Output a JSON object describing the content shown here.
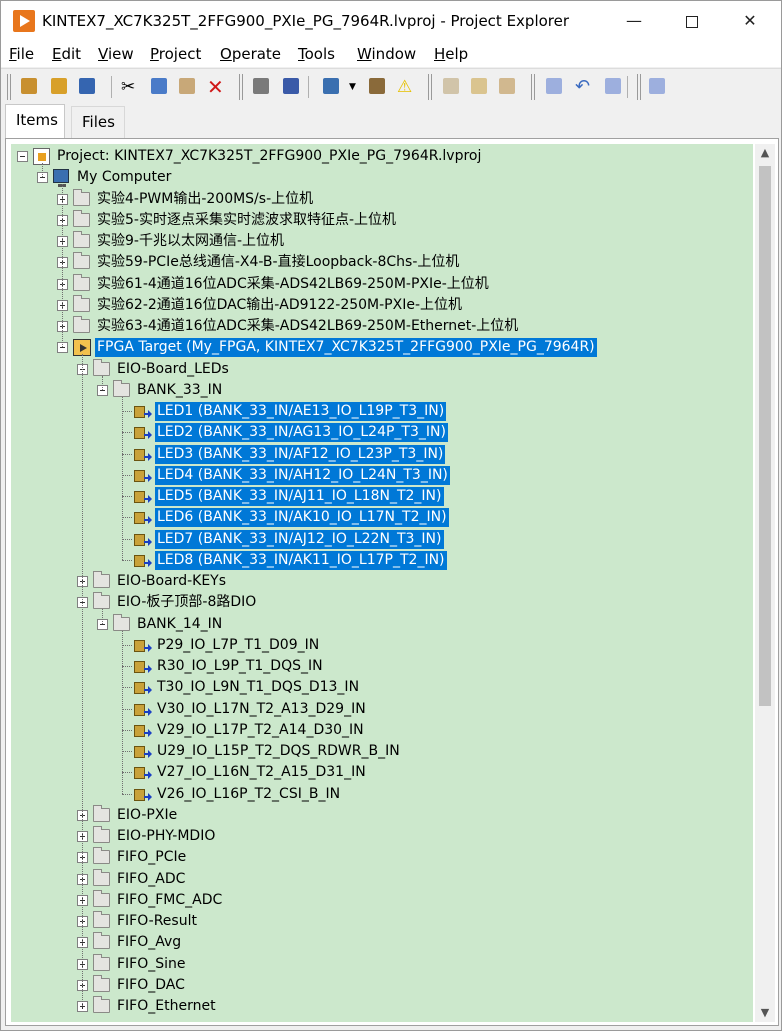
{
  "window": {
    "title": "KINTEX7_XC7K325T_2FFG900_PXIe_PG_7964R.lvproj - Project Explorer",
    "min_glyph": "—",
    "close_glyph": "✕"
  },
  "menu": [
    {
      "label": "File"
    },
    {
      "label": "Edit"
    },
    {
      "label": "View"
    },
    {
      "label": "Project"
    },
    {
      "label": "Operate"
    },
    {
      "label": "Tools"
    },
    {
      "label": "Window"
    },
    {
      "label": "Help"
    }
  ],
  "toolbar": {
    "icons": [
      "new-icon",
      "open-icon",
      "save-all-icon",
      "cut-icon",
      "copy-icon",
      "paste-icon",
      "delete-icon",
      "build-icon",
      "save-icon",
      "view-icon",
      "dropdown-icon",
      "deploy-icon",
      "warning-icon",
      "build-spec-icon",
      "properties-icon",
      "refresh-icon",
      "find-icon",
      "undo-icon",
      "redo-icon",
      "add-icon"
    ]
  },
  "tabs": [
    {
      "label": "Items"
    },
    {
      "label": "Files"
    }
  ],
  "tree": [
    {
      "label": "Project: KINTEX7_XC7K325T_2FFG900_PXIe_PG_7964R.lvproj",
      "icon": "project-icon",
      "level": 0,
      "expander": "minus"
    },
    {
      "label": "My Computer",
      "icon": "computer-icon",
      "level": 1,
      "expander": "minus"
    },
    {
      "label": "实验4-PWM输出-200MS/s-上位机",
      "icon": "folder-icon",
      "level": 2,
      "expander": "plus"
    },
    {
      "label": "实验5-实时逐点采集实时滤波求取特征点-上位机",
      "icon": "folder-icon",
      "level": 2,
      "expander": "plus"
    },
    {
      "label": "实验9-千兆以太网通信-上位机",
      "icon": "folder-icon",
      "level": 2,
      "expander": "plus"
    },
    {
      "label": "实验59-PCIe总线通信-X4-B-直接Loopback-8Chs-上位机",
      "icon": "folder-icon",
      "level": 2,
      "expander": "plus"
    },
    {
      "label": "实验61-4通道16位ADC采集-ADS42LB69-250M-PXIe-上位机",
      "icon": "folder-icon",
      "level": 2,
      "expander": "plus"
    },
    {
      "label": "实验62-2通道16位DAC输出-AD9122-250M-PXIe-上位机",
      "icon": "folder-icon",
      "level": 2,
      "expander": "plus"
    },
    {
      "label": "实验63-4通道16位ADC采集-ADS42LB69-250M-Ethernet-上位机",
      "icon": "folder-icon",
      "level": 2,
      "expander": "plus"
    },
    {
      "label": "FPGA Target (My_FPGA, KINTEX7_XC7K325T_2FFG900_PXIe_PG_7964R)",
      "icon": "fpga-target-icon",
      "level": 2,
      "expander": "minus",
      "selected": true
    },
    {
      "label": "EIO-Board_LEDs",
      "icon": "folder-icon",
      "level": 3,
      "expander": "minus"
    },
    {
      "label": "BANK_33_IN",
      "icon": "folder-icon",
      "level": 4,
      "expander": "minus"
    },
    {
      "label": "LED1 (BANK_33_IN/AE13_IO_L19P_T3_IN)",
      "icon": "io-node-icon",
      "level": 5,
      "selected": true
    },
    {
      "label": "LED2 (BANK_33_IN/AG13_IO_L24P_T3_IN)",
      "icon": "io-node-icon",
      "level": 5,
      "selected": true
    },
    {
      "label": "LED3 (BANK_33_IN/AF12_IO_L23P_T3_IN)",
      "icon": "io-node-icon",
      "level": 5,
      "selected": true
    },
    {
      "label": "LED4 (BANK_33_IN/AH12_IO_L24N_T3_IN)",
      "icon": "io-node-icon",
      "level": 5,
      "selected": true
    },
    {
      "label": "LED5 (BANK_33_IN/AJ11_IO_L18N_T2_IN)",
      "icon": "io-node-icon",
      "level": 5,
      "selected": true
    },
    {
      "label": "LED6 (BANK_33_IN/AK10_IO_L17N_T2_IN)",
      "icon": "io-node-icon",
      "level": 5,
      "selected": true
    },
    {
      "label": "LED7 (BANK_33_IN/AJ12_IO_L22N_T3_IN)",
      "icon": "io-node-icon",
      "level": 5,
      "selected": true
    },
    {
      "label": "LED8 (BANK_33_IN/AK11_IO_L17P_T2_IN)",
      "icon": "io-node-icon",
      "level": 5,
      "selected": true
    },
    {
      "label": "EIO-Board-KEYs",
      "icon": "folder-icon",
      "level": 3,
      "expander": "plus"
    },
    {
      "label": "EIO-板子顶部-8路DIO",
      "icon": "folder-icon",
      "level": 3,
      "expander": "minus"
    },
    {
      "label": "BANK_14_IN",
      "icon": "folder-icon",
      "level": 4,
      "expander": "minus"
    },
    {
      "label": "P29_IO_L7P_T1_D09_IN",
      "icon": "io-node-icon",
      "level": 5
    },
    {
      "label": "R30_IO_L9P_T1_DQS_IN",
      "icon": "io-node-icon",
      "level": 5
    },
    {
      "label": "T30_IO_L9N_T1_DQS_D13_IN",
      "icon": "io-node-icon",
      "level": 5
    },
    {
      "label": "V30_IO_L17N_T2_A13_D29_IN",
      "icon": "io-node-icon",
      "level": 5
    },
    {
      "label": "V29_IO_L17P_T2_A14_D30_IN",
      "icon": "io-node-icon",
      "level": 5
    },
    {
      "label": "U29_IO_L15P_T2_DQS_RDWR_B_IN",
      "icon": "io-node-icon",
      "level": 5
    },
    {
      "label": "V27_IO_L16N_T2_A15_D31_IN",
      "icon": "io-node-icon",
      "level": 5
    },
    {
      "label": "V26_IO_L16P_T2_CSI_B_IN",
      "icon": "io-node-icon",
      "level": 5
    },
    {
      "label": "EIO-PXIe",
      "icon": "folder-icon",
      "level": 3,
      "expander": "plus"
    },
    {
      "label": "EIO-PHY-MDIO",
      "icon": "folder-icon",
      "level": 3,
      "expander": "plus"
    },
    {
      "label": "FIFO_PCIe",
      "icon": "folder-icon",
      "level": 3,
      "expander": "plus"
    },
    {
      "label": "FIFO_ADC",
      "icon": "folder-icon",
      "level": 3,
      "expander": "plus"
    },
    {
      "label": "FIFO_FMC_ADC",
      "icon": "folder-icon",
      "level": 3,
      "expander": "plus"
    },
    {
      "label": "FIFO-Result",
      "icon": "folder-icon",
      "level": 3,
      "expander": "plus"
    },
    {
      "label": "FIFO_Avg",
      "icon": "folder-icon",
      "level": 3,
      "expander": "plus"
    },
    {
      "label": "FIFO_Sine",
      "icon": "folder-icon",
      "level": 3,
      "expander": "plus"
    },
    {
      "label": "FIFO_DAC",
      "icon": "folder-icon",
      "level": 3,
      "expander": "plus"
    },
    {
      "label": "FIFO_Ethernet",
      "icon": "folder-icon",
      "level": 3,
      "expander": "plus"
    }
  ],
  "colors": {
    "tree_background": "#cce8cc",
    "selection": "#0078d7",
    "accent_icon": "#e8761c"
  }
}
